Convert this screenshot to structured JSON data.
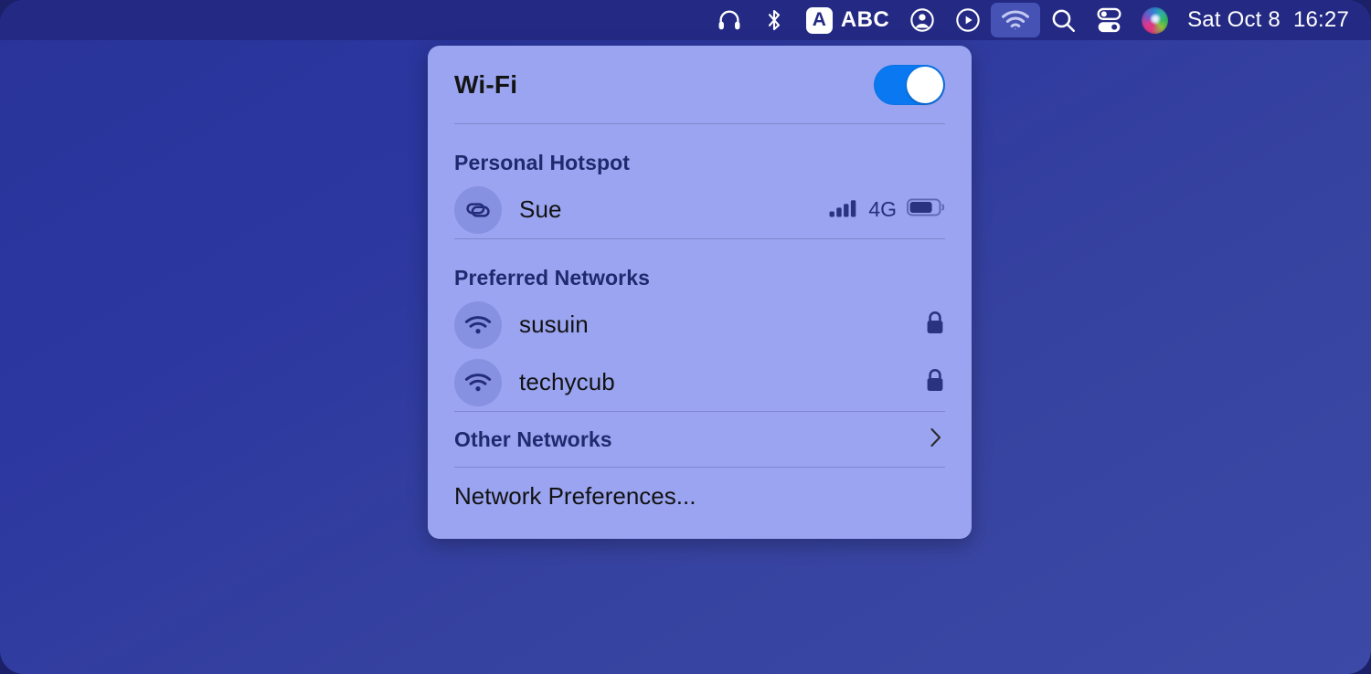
{
  "menubar": {
    "items": [
      {
        "name": "headphones-icon",
        "label": "Headphones"
      },
      {
        "name": "bluetooth-icon",
        "label": "Bluetooth"
      },
      {
        "name": "input-source-badge",
        "label": "A"
      },
      {
        "name": "input-source-text",
        "label": "ABC"
      },
      {
        "name": "user-account-icon",
        "label": "Fast User Switching"
      },
      {
        "name": "now-playing-icon",
        "label": "Now Playing"
      },
      {
        "name": "wifi-icon",
        "label": "Wi-Fi"
      },
      {
        "name": "spotlight-search-icon",
        "label": "Spotlight Search"
      },
      {
        "name": "control-center-icon",
        "label": "Control Center"
      },
      {
        "name": "siri-icon",
        "label": "Siri"
      }
    ],
    "input_source_badge": "A",
    "input_source_label": "ABC",
    "clock_date": "Sat Oct 8",
    "clock_time": "16:27",
    "active_item": "wifi-icon",
    "bar_color": "#242a84",
    "highlight_color": "#4652b4"
  },
  "wifi_panel": {
    "title": "Wi-Fi",
    "toggle_state": "on",
    "toggle_color": "#0a78f0",
    "panel_color": "#9aa4f0",
    "personal_hotspot": {
      "heading": "Personal Hotspot",
      "device_name": "Sue",
      "signal_bars": 4,
      "signal_bars_total": 4,
      "network_generation": "4G",
      "battery_level_percent": 70
    },
    "preferred_networks": {
      "heading": "Preferred Networks",
      "networks": [
        {
          "ssid": "susuin",
          "secured": true
        },
        {
          "ssid": "techycub",
          "secured": true
        }
      ]
    },
    "other_networks": {
      "label": "Other Networks",
      "has_submenu": true
    },
    "network_preferences": {
      "label": "Network Preferences..."
    }
  },
  "desktop": {
    "gradient_start": "#29349a",
    "gradient_end": "#3c49a6"
  }
}
